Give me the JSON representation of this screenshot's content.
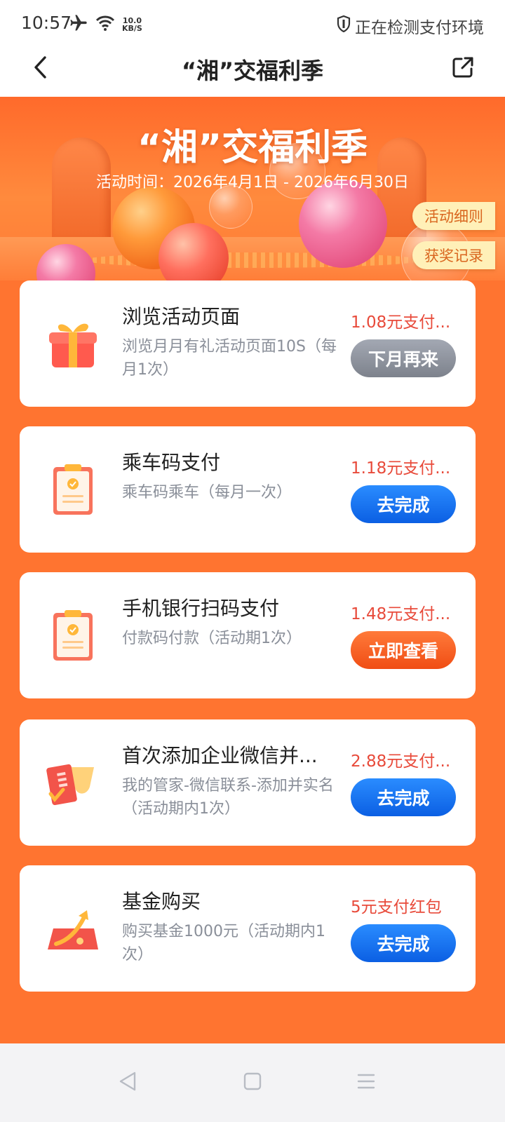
{
  "status_bar": {
    "time": "10:57",
    "net_speed_value": "10.0",
    "net_speed_unit": "KB/S",
    "security_text": "正在检测支付环境"
  },
  "nav": {
    "title": "“湘”交福利季"
  },
  "banner": {
    "title": "“湘”交福利季",
    "activity_time": "活动时间：2026年4月1日 - 2026年6月30日",
    "rules_label": "活动细则",
    "records_label": "获奖记录"
  },
  "tasks": [
    {
      "title": "浏览活动页面",
      "desc": "浏览月月有礼活动页面10S（每月1次）",
      "reward": "1.08元支付...",
      "button": "下月再来",
      "button_style": "gray",
      "icon": "gift-box-icon"
    },
    {
      "title": "乘车码支付",
      "desc": "乘车码乘车（每月一次）",
      "reward": "1.18元支付...",
      "button": "去完成",
      "button_style": "blue",
      "icon": "clipboard-icon"
    },
    {
      "title": "手机银行扫码支付",
      "desc": "付款码付款（活动期1次）",
      "reward": "1.48元支付...",
      "button": "立即查看",
      "button_style": "orange",
      "icon": "clipboard-icon"
    },
    {
      "title": "首次添加企业微信并...",
      "desc": "我的管家-微信联系-添加并实名（活动期内1次）",
      "reward": "2.88元支付...",
      "button": "去完成",
      "button_style": "blue",
      "icon": "card-verify-icon"
    },
    {
      "title": "基金购买",
      "desc": "购买基金1000元（活动期内1次）",
      "reward": "5元支付红包",
      "button": "去完成",
      "button_style": "blue",
      "icon": "fund-growth-icon"
    }
  ],
  "colors": {
    "page_orange": "#ff7430",
    "reward_red": "#e84a3a",
    "button_blue": "#0b5fe3",
    "button_gray": "#7d828c",
    "button_orange": "#f04d14",
    "tag_bg": "#fff0b8"
  }
}
